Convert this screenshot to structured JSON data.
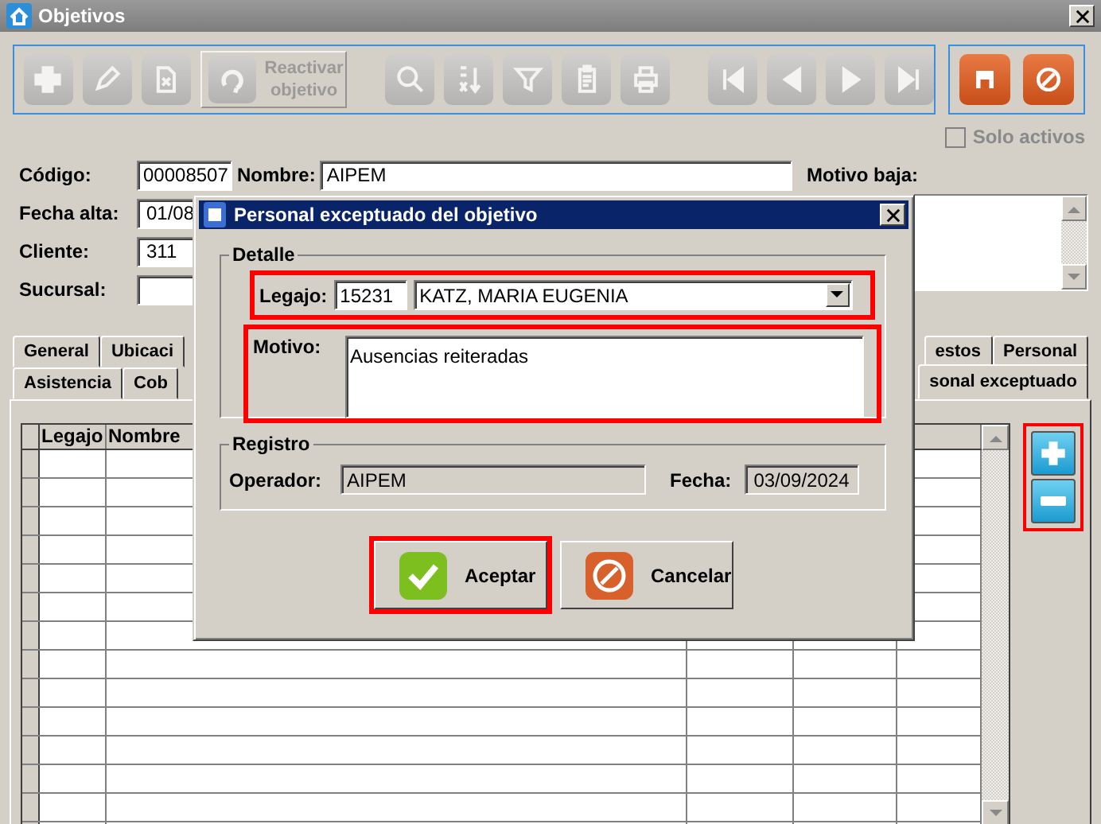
{
  "window": {
    "title": "Objetivos"
  },
  "toolbar": {
    "buttons": [
      {
        "kind": "add",
        "disabled": true
      },
      {
        "kind": "edit",
        "disabled": true
      },
      {
        "kind": "delete",
        "disabled": true
      },
      {
        "kind": "reactivate",
        "label": "Reactivar objetivo",
        "disabled": true
      },
      {
        "kind": "search",
        "disabled": true
      },
      {
        "kind": "sort",
        "disabled": true
      },
      {
        "kind": "filter",
        "disabled": true
      },
      {
        "kind": "clipboard",
        "disabled": true
      },
      {
        "kind": "print",
        "disabled": true
      },
      {
        "kind": "first",
        "disabled": true
      },
      {
        "kind": "prev",
        "disabled": true
      },
      {
        "kind": "next",
        "disabled": true
      },
      {
        "kind": "last",
        "disabled": true
      }
    ],
    "actions": [
      {
        "kind": "save",
        "disabled": false
      },
      {
        "kind": "cancel",
        "disabled": false
      }
    ]
  },
  "solo_activos": {
    "label": "Solo activos",
    "checked": false,
    "disabled": true
  },
  "form": {
    "codigo": {
      "label": "Código:",
      "value": "00008507"
    },
    "nombre": {
      "label": "Nombre:",
      "value": "AIPEM"
    },
    "motivo_baja": {
      "label": "Motivo baja:"
    },
    "fecha_alta": {
      "label": "Fecha alta:",
      "value": "01/08"
    },
    "cliente": {
      "label": "Cliente:",
      "value": "311"
    },
    "sucursal": {
      "label": "Sucursal:"
    }
  },
  "tabs_row_1": [
    {
      "label": "General",
      "selected": false
    },
    {
      "label": "Ubicaci",
      "selected": false
    },
    {
      "label": "estos",
      "selected": false
    },
    {
      "label": "Personal",
      "selected": false
    }
  ],
  "tabs_row_2": [
    {
      "label": "Asistencia",
      "selected": false
    },
    {
      "label": "Cob",
      "selected": false
    },
    {
      "label": "sonal exceptuado",
      "selected": true
    }
  ],
  "grid": {
    "columns": [
      {
        "label": "Legajo"
      },
      {
        "label": "Nombre"
      }
    ]
  },
  "side_buttons": {
    "highlighted": true,
    "items": [
      {
        "kind": "add"
      },
      {
        "kind": "remove"
      }
    ]
  },
  "dialog": {
    "title": "Personal exceptuado del objetivo",
    "detalle": {
      "title": "Detalle",
      "legajo": {
        "label": "Legajo:",
        "code": "15231",
        "name": "KATZ, MARIA EUGENIA",
        "highlighted": true
      },
      "motivo": {
        "label": "Motivo:",
        "value": "Ausencias reiteradas",
        "highlighted": true
      }
    },
    "registro": {
      "title": "Registro",
      "operador": {
        "label": "Operador:",
        "value": "AIPEM"
      },
      "fecha": {
        "label": "Fecha:",
        "value": "03/09/2024"
      }
    },
    "buttons": [
      {
        "kind": "accept",
        "label": "Aceptar",
        "highlighted": true
      },
      {
        "kind": "cancel",
        "label": "Cancelar",
        "highlighted": false
      }
    ]
  }
}
